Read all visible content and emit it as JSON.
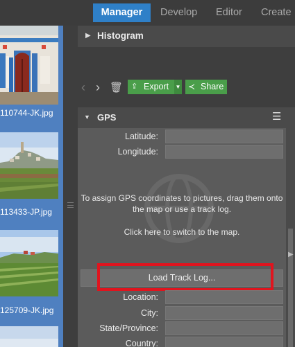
{
  "tabs": [
    {
      "label": "Manager"
    },
    {
      "label": "Develop"
    },
    {
      "label": "Editor"
    },
    {
      "label": "Create"
    }
  ],
  "filmstrip": {
    "items": [
      {
        "filename": "110744-JK.jpg"
      },
      {
        "filename": "113433-JP.jpg"
      },
      {
        "filename": "125709-JK.jpg"
      }
    ]
  },
  "histogram": {
    "title": "Histogram"
  },
  "toolbar": {
    "export_label": "Export",
    "share_label": "Share",
    "icons": [
      "arrow-left-icon",
      "arrow-right-icon",
      "trash-icon",
      "rotate-left-icon",
      "rotate-right-icon",
      "copy-icon",
      "paste-icon",
      "clear-icon",
      "tools-icon",
      "effects-icon",
      "more-icon",
      "comment-icon"
    ]
  },
  "gps": {
    "title": "GPS",
    "latitude_label": "Latitude:",
    "latitude_value": "",
    "longitude_label": "Longitude:",
    "longitude_value": "",
    "info_line1": "To assign GPS coordinates to pictures, drag them onto",
    "info_line2": "the map or use a track log.",
    "switch_text": "Click here to switch to the map.",
    "load_track_label": "Load Track Log...",
    "location_label": "Location:",
    "city_label": "City:",
    "state_label": "State/Province:",
    "country_label": "Country:"
  },
  "colors": {
    "accent": "#2f80c8",
    "action_green": "#4a9e4a",
    "highlight_red": "#e0141e",
    "filmstrip_selected": "#4f80c0"
  }
}
